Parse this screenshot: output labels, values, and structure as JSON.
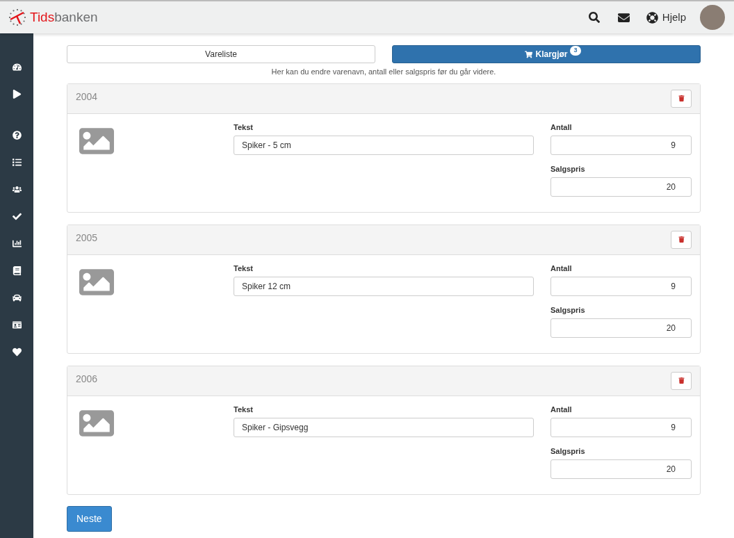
{
  "header": {
    "logo": {
      "first": "Tids",
      "second": "banken"
    },
    "help": "Hjelp"
  },
  "steps": [
    {
      "label": "Vareliste",
      "selected": false
    },
    {
      "label": "Klargjør",
      "selected": true,
      "badge": "3"
    }
  ],
  "hint": "Her kan du endre varenavn, antall eller salgspris før du går videre.",
  "items": [
    {
      "number": "2004",
      "text_label": "Tekst",
      "text": "Spiker - 5 cm",
      "qty_label": "Antall",
      "qty": "9",
      "price_label": "Salgspris",
      "price": "20"
    },
    {
      "number": "2005",
      "text_label": "Tekst",
      "text": "Spiker 12 cm",
      "qty_label": "Antall",
      "qty": "9",
      "price_label": "Salgspris",
      "price": "20"
    },
    {
      "number": "2006",
      "text_label": "Tekst",
      "text": "Spiker - Gipsvegg",
      "qty_label": "Antall",
      "qty": "9",
      "price_label": "Salgspris",
      "price": "20"
    }
  ],
  "next_button": "Neste"
}
